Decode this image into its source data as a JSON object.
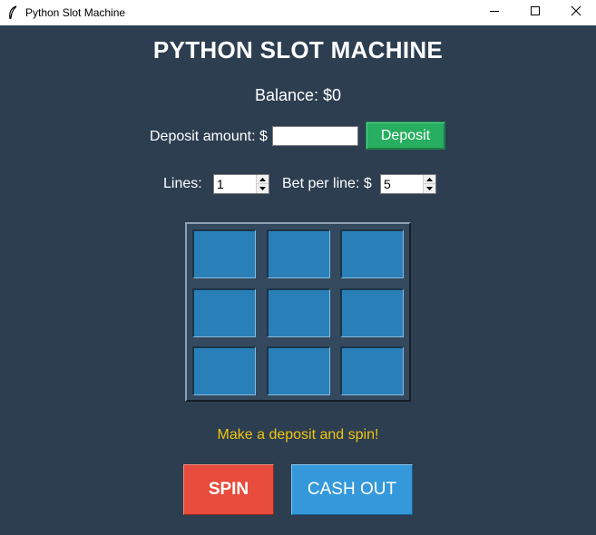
{
  "window": {
    "title": "Python Slot Machine",
    "icon": "feather-icon",
    "controls": [
      "minimize-icon",
      "maximize-icon",
      "close-icon"
    ]
  },
  "app": {
    "title": "PYTHON SLOT MACHINE",
    "balance": "Balance: $0"
  },
  "deposit": {
    "label": "Deposit amount: $",
    "value": "",
    "button_label": "Deposit"
  },
  "bet": {
    "lines_label": "Lines:",
    "lines_value": "1",
    "bet_label": "Bet per line: $",
    "bet_value": "5"
  },
  "reels": {
    "rows": 3,
    "cols": 3,
    "symbols": [
      "",
      "",
      "",
      "",
      "",
      "",
      "",
      "",
      ""
    ]
  },
  "message": "Make a deposit and spin!",
  "buttons": {
    "spin_label": "SPIN",
    "cashout_label": "CASH OUT"
  },
  "colors": {
    "background": "#2c3e50",
    "deposit_button": "#27ae60",
    "reel_cell": "#2980b9",
    "message": "#f1c40f",
    "spin_button": "#e74c3c",
    "cashout_button": "#3498db"
  }
}
